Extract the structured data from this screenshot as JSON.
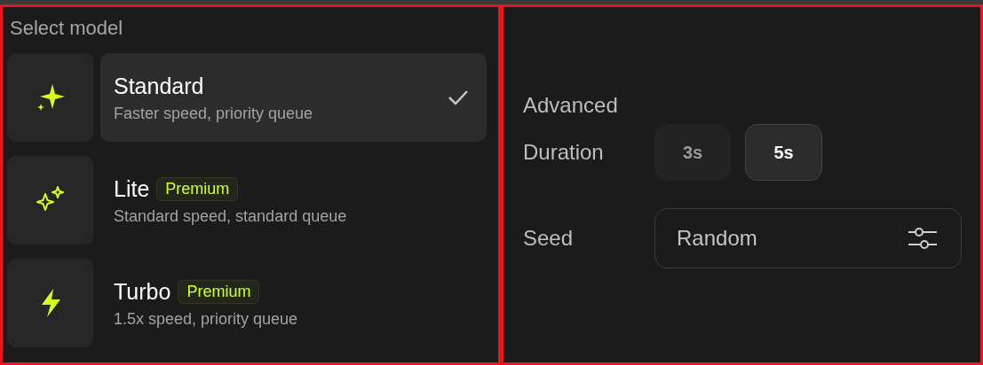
{
  "models_panel": {
    "title": "Select model",
    "models": [
      {
        "name": "Standard",
        "kind": "sparkle",
        "premium": false,
        "description": "Faster speed, priority queue",
        "selected": true
      },
      {
        "name": "Lite",
        "kind": "sparkles",
        "premium": true,
        "badge": "Premium",
        "description": "Standard speed, standard queue",
        "selected": false
      },
      {
        "name": "Turbo",
        "kind": "bolt",
        "premium": true,
        "badge": "Premium",
        "description": "1.5x speed, priority queue",
        "selected": false
      }
    ]
  },
  "advanced_panel": {
    "title": "Advanced",
    "duration": {
      "label": "Duration",
      "options": [
        {
          "label": "3s",
          "selected": false
        },
        {
          "label": "5s",
          "selected": true
        }
      ]
    },
    "seed": {
      "label": "Seed",
      "value": "Random"
    }
  }
}
